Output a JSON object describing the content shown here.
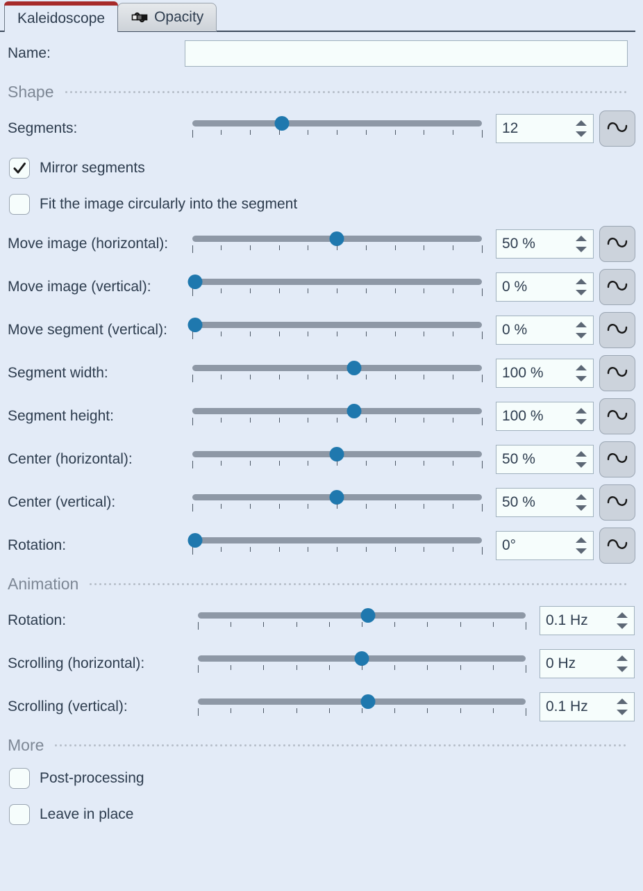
{
  "tabs": [
    {
      "label": "Kaleidoscope",
      "active": true,
      "icon": null
    },
    {
      "label": "Opacity",
      "active": false,
      "icon": "curve-node-icon"
    }
  ],
  "name_field": {
    "label": "Name:",
    "value": "",
    "placeholder": ""
  },
  "sections": {
    "shape": {
      "title": "Shape"
    },
    "animation": {
      "title": "Animation"
    },
    "more": {
      "title": "More"
    }
  },
  "shape_rows": [
    {
      "label": "Segments:",
      "value": "12",
      "pos": 31,
      "wave": true
    },
    {
      "label": "Move image (horizontal):",
      "value": "50 %",
      "pos": 50,
      "wave": true
    },
    {
      "label": "Move image (vertical):",
      "value": "0 %",
      "pos": 1,
      "wave": true
    },
    {
      "label": "Move segment (vertical):",
      "value": "0 %",
      "pos": 1,
      "wave": true
    },
    {
      "label": "Segment width:",
      "value": "100 %",
      "pos": 56,
      "wave": true
    },
    {
      "label": "Segment height:",
      "value": "100 %",
      "pos": 56,
      "wave": true
    },
    {
      "label": "Center (horizontal):",
      "value": "50 %",
      "pos": 50,
      "wave": true
    },
    {
      "label": "Center (vertical):",
      "value": "50 %",
      "pos": 50,
      "wave": true
    },
    {
      "label": "Rotation:",
      "value": "0°",
      "pos": 1,
      "wave": true
    }
  ],
  "shape_checks": [
    {
      "label": "Mirror segments",
      "checked": true
    },
    {
      "label": "Fit the image circularly into the segment",
      "checked": false
    }
  ],
  "animation_rows": [
    {
      "label": "Rotation:",
      "value": "0.1 Hz",
      "pos": 52,
      "wave": false
    },
    {
      "label": "Scrolling (horizontal):",
      "value": "0 Hz",
      "pos": 50,
      "wave": false
    },
    {
      "label": "Scrolling (vertical):",
      "value": "0.1 Hz",
      "pos": 52,
      "wave": false
    }
  ],
  "more_checks": [
    {
      "label": "Post-processing",
      "checked": false
    },
    {
      "label": "Leave in place",
      "checked": false
    }
  ],
  "icons": {
    "wave": "sine-wave-icon",
    "spin_up": "spinner-up-arrow-icon",
    "spin_down": "spinner-down-arrow-icon",
    "checkmark": "checkmark-icon"
  },
  "colors": {
    "background": "#e3ebf7",
    "accent_tab": "#a62a2a",
    "slider_handle": "#1f78ae",
    "slider_track": "#8e98a6",
    "section_title": "#7d8795",
    "text": "#2d3c4e"
  }
}
